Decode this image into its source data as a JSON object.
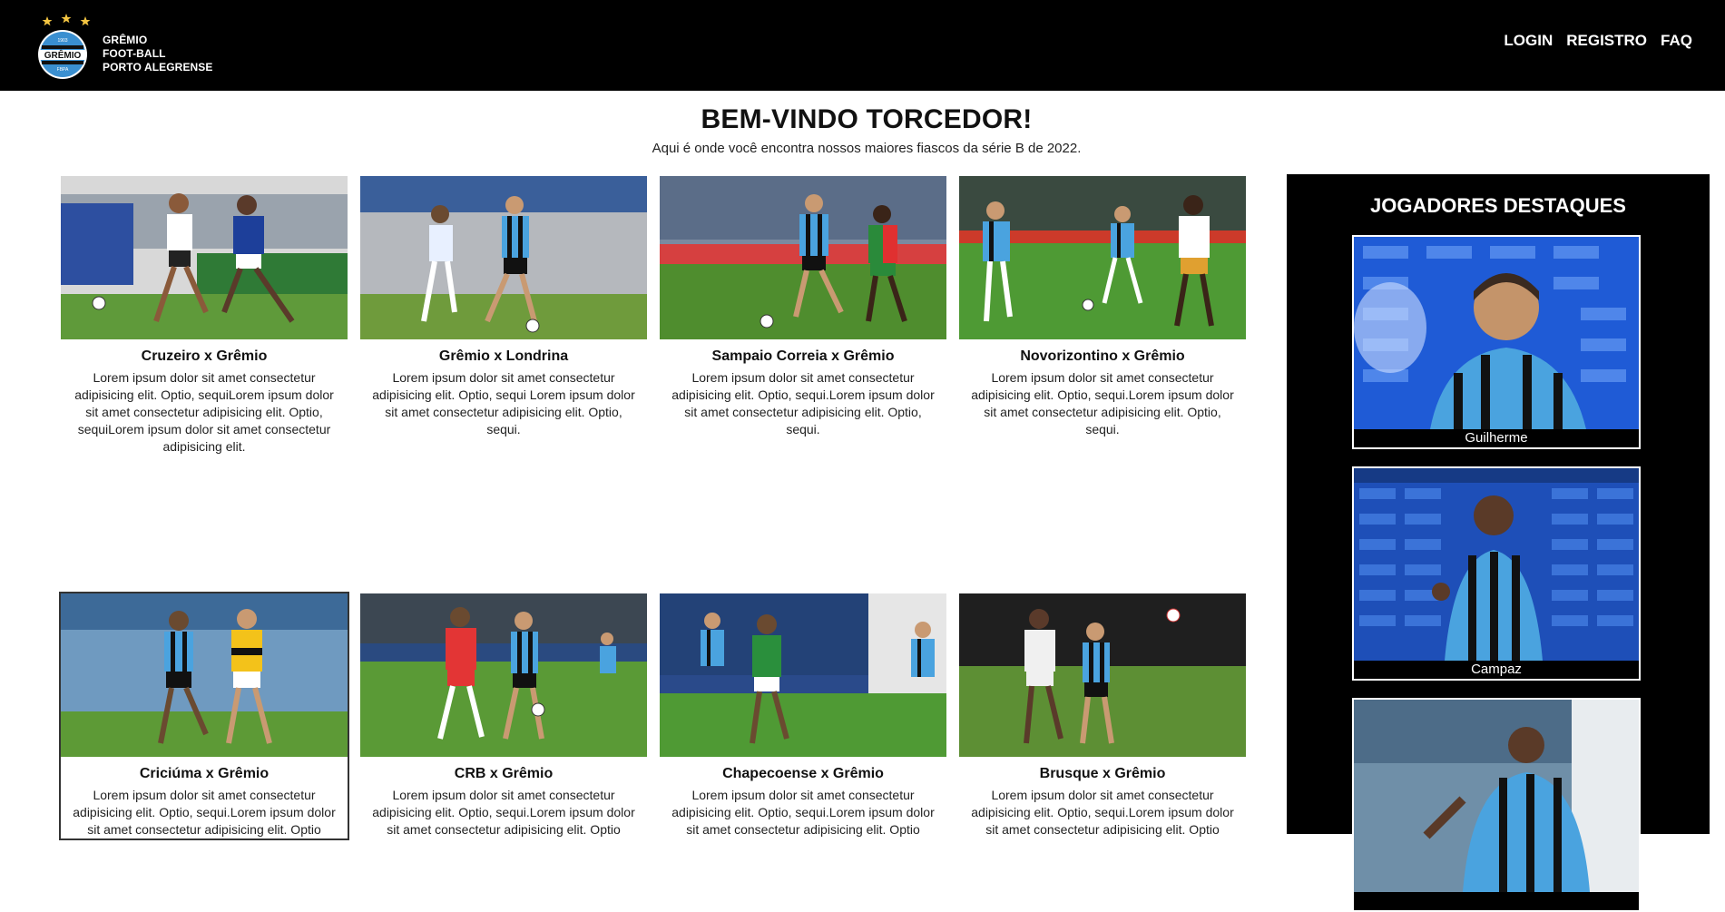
{
  "header": {
    "logo_text": "GRÊMIO",
    "logo_year": "1903",
    "logo_sub": "FBPA",
    "brand_lines": [
      "GRÊMIO",
      "FOOT-BALL",
      "PORTO ALEGRENSE"
    ],
    "nav": [
      "LOGIN",
      "REGISTRO",
      "FAQ"
    ]
  },
  "intro": {
    "title": "BEM-VINDO TORCEDOR!",
    "subtitle": "Aqui é onde você encontra nossos maiores fiascos da série B de 2022."
  },
  "matches": [
    {
      "title": "Cruzeiro x Grêmio",
      "text": "Lorem ipsum dolor sit amet consectetur adipisicing elit. Optio, sequiLorem ipsum dolor sit amet consectetur adipisicing elit. Optio, sequiLorem ipsum dolor sit amet consectetur adipisicing elit."
    },
    {
      "title": "Grêmio x Londrina",
      "text": "Lorem ipsum dolor sit amet consectetur adipisicing elit. Optio, sequi Lorem ipsum dolor sit amet consectetur adipisicing elit. Optio, sequi."
    },
    {
      "title": "Sampaio Correia x Grêmio",
      "text": "Lorem ipsum dolor sit amet consectetur adipisicing elit. Optio, sequi.Lorem ipsum dolor sit amet consectetur adipisicing elit. Optio, sequi."
    },
    {
      "title": "Novorizontino x Grêmio",
      "text": "Lorem ipsum dolor sit amet consectetur adipisicing elit. Optio, sequi.Lorem ipsum dolor sit amet consectetur adipisicing elit. Optio, sequi."
    },
    {
      "title": "Criciúma x Grêmio",
      "text": "Lorem ipsum dolor sit amet consectetur adipisicing elit. Optio, sequi.Lorem ipsum dolor sit amet consectetur adipisicing elit. Optio"
    },
    {
      "title": "CRB x Grêmio",
      "text": "Lorem ipsum dolor sit amet consectetur adipisicing elit. Optio, sequi.Lorem ipsum dolor sit amet consectetur adipisicing elit. Optio"
    },
    {
      "title": "Chapecoense x Grêmio",
      "text": "Lorem ipsum dolor sit amet consectetur adipisicing elit. Optio, sequi.Lorem ipsum dolor sit amet consectetur adipisicing elit. Optio"
    },
    {
      "title": "Brusque x Grêmio",
      "text": "Lorem ipsum dolor sit amet consectetur adipisicing elit. Optio, sequi.Lorem ipsum dolor sit amet consectetur adipisicing elit. Optio"
    }
  ],
  "sidebar": {
    "title": "JOGADORES DESTAQUES",
    "players": [
      "Guilherme",
      "Campaz",
      ""
    ]
  },
  "colors": {
    "header_bg": "#000000",
    "gremio_blue": "#4aa3df",
    "gremio_black": "#111111",
    "grass": "#3f8f2a"
  }
}
